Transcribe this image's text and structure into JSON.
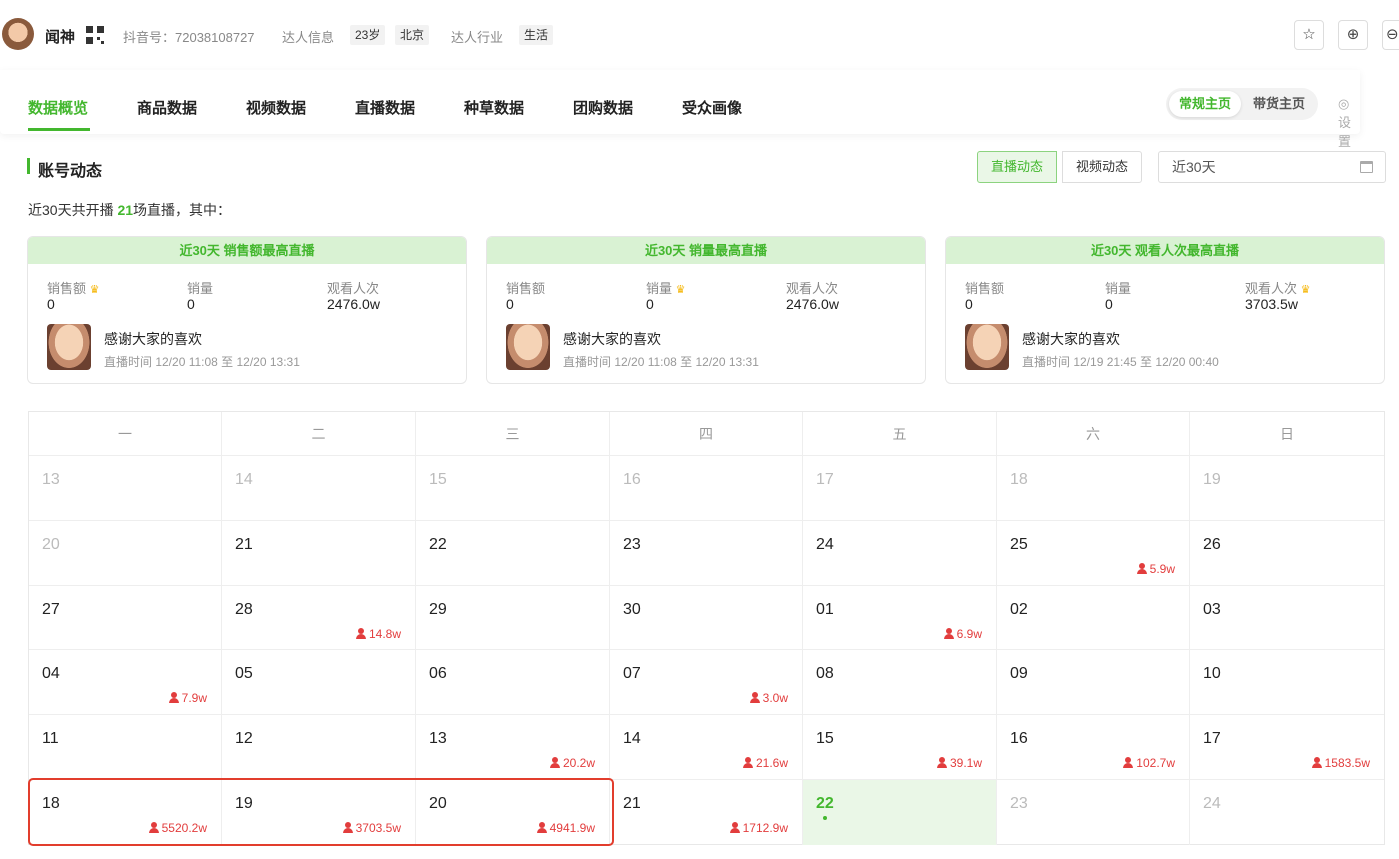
{
  "profile": {
    "name": "闻神",
    "douyin_label": "抖音号：72038108727",
    "info_label": "达人信息",
    "age": "23岁",
    "city": "北京",
    "industry_label": "达人行业",
    "industry": "生活"
  },
  "header_actions": {
    "star_icon": "☆",
    "add_icon": "⊕",
    "more_icon": "⊖"
  },
  "tabs": [
    {
      "label": "数据概览",
      "active": true
    },
    {
      "label": "商品数据"
    },
    {
      "label": "视频数据"
    },
    {
      "label": "直播数据"
    },
    {
      "label": "种草数据"
    },
    {
      "label": "团购数据"
    },
    {
      "label": "受众画像"
    }
  ],
  "home_switch": {
    "normal": "常规主页",
    "goods": "带货主页"
  },
  "settings_label": "◎ 设置",
  "section": {
    "title": "账号动态",
    "toggle_live": "直播动态",
    "toggle_video": "视频动态",
    "date_range": "近30天"
  },
  "summary": {
    "prefix": "近30天共开播 ",
    "count": "21",
    "suffix": "场直播，其中："
  },
  "cards": [
    {
      "title": "近30天 销售额最高直播",
      "metrics": [
        {
          "label": "销售额",
          "value": "0",
          "crown": true
        },
        {
          "label": "销量",
          "value": "0",
          "crown": false
        },
        {
          "label": "观看人次",
          "value": "2476.0w",
          "crown": false
        }
      ],
      "live_title": "感谢大家的喜欢",
      "live_time": "直播时间 12/20 11:08 至 12/20 13:31"
    },
    {
      "title": "近30天 销量最高直播",
      "metrics": [
        {
          "label": "销售额",
          "value": "0",
          "crown": false
        },
        {
          "label": "销量",
          "value": "0",
          "crown": true
        },
        {
          "label": "观看人次",
          "value": "2476.0w",
          "crown": false
        }
      ],
      "live_title": "感谢大家的喜欢",
      "live_time": "直播时间 12/20 11:08 至 12/20 13:31"
    },
    {
      "title": "近30天 观看人次最高直播",
      "metrics": [
        {
          "label": "销售额",
          "value": "0",
          "crown": false
        },
        {
          "label": "销量",
          "value": "0",
          "crown": false
        },
        {
          "label": "观看人次",
          "value": "3703.5w",
          "crown": true
        }
      ],
      "live_title": "感谢大家的喜欢",
      "live_time": "直播时间 12/19 21:45 至 12/20 00:40"
    }
  ],
  "calendar": {
    "weekdays": [
      "一",
      "二",
      "三",
      "四",
      "五",
      "六",
      "日"
    ],
    "weeks": [
      [
        {
          "d": "13",
          "dim": true
        },
        {
          "d": "14",
          "dim": true
        },
        {
          "d": "15",
          "dim": true
        },
        {
          "d": "16",
          "dim": true
        },
        {
          "d": "17",
          "dim": true
        },
        {
          "d": "18",
          "dim": true
        },
        {
          "d": "19",
          "dim": true
        }
      ],
      [
        {
          "d": "20",
          "dim": true
        },
        {
          "d": "21"
        },
        {
          "d": "22"
        },
        {
          "d": "23"
        },
        {
          "d": "24"
        },
        {
          "d": "25",
          "v": "5.9w"
        },
        {
          "d": "26"
        }
      ],
      [
        {
          "d": "27"
        },
        {
          "d": "28",
          "v": "14.8w"
        },
        {
          "d": "29"
        },
        {
          "d": "30"
        },
        {
          "d": "01",
          "v": "6.9w"
        },
        {
          "d": "02"
        },
        {
          "d": "03"
        }
      ],
      [
        {
          "d": "04",
          "v": "7.9w"
        },
        {
          "d": "05"
        },
        {
          "d": "06"
        },
        {
          "d": "07",
          "v": "3.0w"
        },
        {
          "d": "08"
        },
        {
          "d": "09"
        },
        {
          "d": "10"
        }
      ],
      [
        {
          "d": "11"
        },
        {
          "d": "12"
        },
        {
          "d": "13",
          "v": "20.2w"
        },
        {
          "d": "14",
          "v": "21.6w"
        },
        {
          "d": "15",
          "v": "39.1w"
        },
        {
          "d": "16",
          "v": "102.7w"
        },
        {
          "d": "17",
          "v": "1583.5w"
        }
      ],
      [
        {
          "d": "18",
          "v": "5520.2w"
        },
        {
          "d": "19",
          "v": "3703.5w"
        },
        {
          "d": "20",
          "v": "4941.9w"
        },
        {
          "d": "21",
          "v": "1712.9w"
        },
        {
          "d": "22",
          "today": true
        },
        {
          "d": "23",
          "dim": true
        },
        {
          "d": "24",
          "dim": true
        }
      ]
    ]
  },
  "colors": {
    "accent": "#43b72e",
    "views": "#e23d3d",
    "highlight": "#e23d2d"
  }
}
